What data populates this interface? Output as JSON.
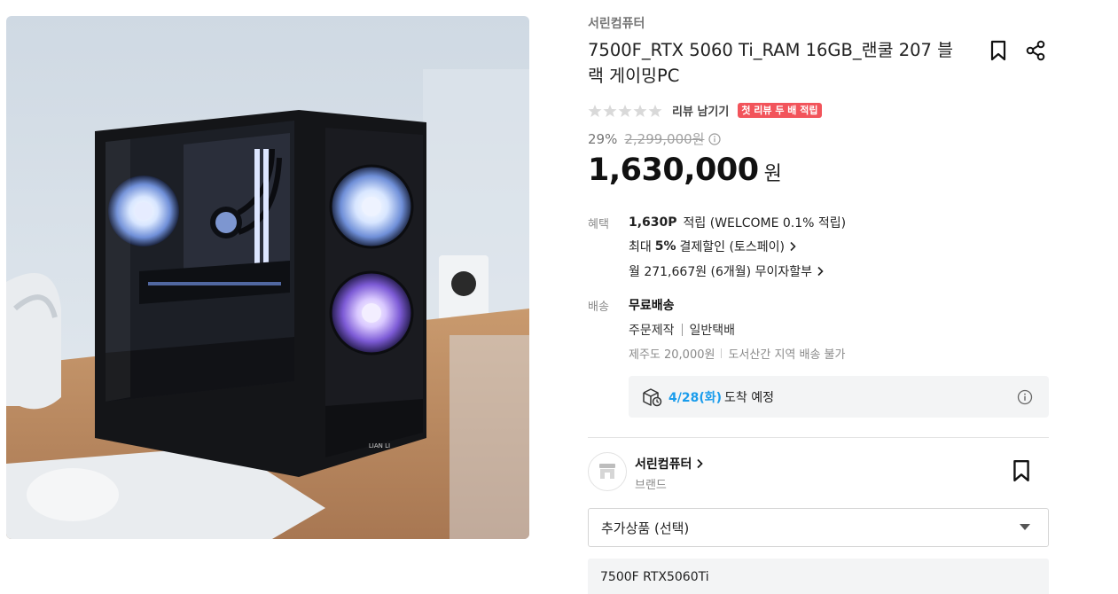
{
  "product": {
    "brand": "서린컴퓨터",
    "title": "7500F_RTX 5060 Ti_RAM 16GB_랜쿨 207 블랙 게이밍PC",
    "case_logo_text": "LIAN LI"
  },
  "icons": {
    "bookmark": "bookmark-icon",
    "share": "share-icon",
    "star": "star-icon",
    "info": "info-icon",
    "truck": "delivery-box-icon",
    "chevron": "chevron-right-icon",
    "caret": "caret-down-icon",
    "store": "store-icon"
  },
  "rating": {
    "stars_filled": 0,
    "stars_total": 5,
    "review_link": "리뷰 남기기",
    "first_review_badge": "첫 리뷰 두 배 적립"
  },
  "pricing": {
    "discount_rate": "29%",
    "original_price": "2,299,000원",
    "sale_price": "1,630,000",
    "currency": "원"
  },
  "benefits": {
    "label": "혜택",
    "points_amount": "1,630P",
    "points_text": "적립 (WELCOME 0.1% 적립)",
    "discount_prefix": "최대",
    "discount_rate": "5%",
    "discount_text": "결제할인 (토스페이)",
    "installment_text": "월 271,667원 (6개월) 무이자할부"
  },
  "shipping": {
    "label": "배송",
    "fee": "무료배송",
    "method_1": "주문제작",
    "method_2": "일반택배",
    "note_1": "제주도 20,000원",
    "note_2": "도서산간 지역 배송 불가",
    "arrival_date": "4/28(화)",
    "arrival_text": "도착 예정"
  },
  "store": {
    "name": "서린컴퓨터",
    "type": "브랜드"
  },
  "options": {
    "select_label": "추가상품 (선택)",
    "preview_item": "7500F RTX5060Ti"
  },
  "colors": {
    "accent_blue": "#1a9cec",
    "badge_red": "#f2545b",
    "text_dark": "#111111",
    "text_muted": "#8a8a8a"
  }
}
